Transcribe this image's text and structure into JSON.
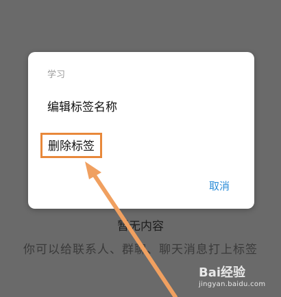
{
  "background": {
    "empty_title": "暂无内容",
    "empty_desc": "你可以给联系人、群聊、聊天消息打上标签"
  },
  "dialog": {
    "title": "学习",
    "options": [
      {
        "label": "编辑标签名称"
      },
      {
        "label": "删除标签"
      }
    ],
    "cancel_label": "取消"
  },
  "colors": {
    "overlay": "#6a6a6a",
    "highlight_box": "#e8883a",
    "cancel": "#2b8dd8",
    "arrow": "#f0a060"
  },
  "watermark": {
    "logo": "Bai经验",
    "url": "jingyan.baidu.com"
  }
}
